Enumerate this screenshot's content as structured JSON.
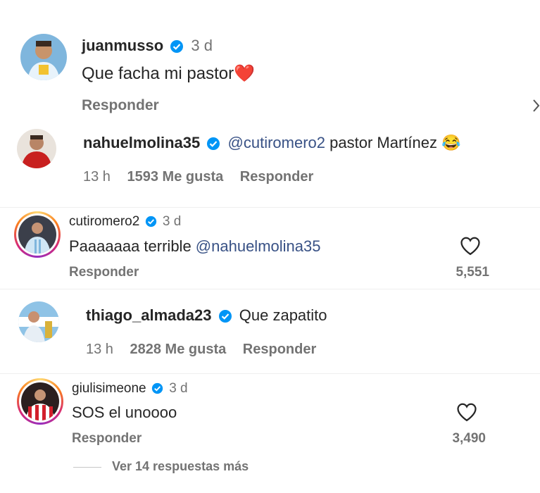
{
  "comments": [
    {
      "username": "juanmusso",
      "time": "3 d",
      "text": "Que facha mi pastor",
      "emoji": "❤️",
      "reply": "Responder"
    },
    {
      "username": "nahuelmolina35",
      "mention": "@cutiromero2",
      "text": " pastor Martínez",
      "emoji": "😂",
      "time": "13 h",
      "likes": "1593 Me gusta",
      "reply": "Responder"
    },
    {
      "username": "cutiromero2",
      "time": "3 d",
      "text": "Paaaaaaa terrible ",
      "mention": "@nahuelmolina35",
      "reply": "Responder",
      "like_count": "5,551"
    },
    {
      "username": "thiago_almada23",
      "text": "Que zapatito",
      "time": "13 h",
      "likes": "2828 Me gusta",
      "reply": "Responder"
    },
    {
      "username": "giulisimeone",
      "time": "3 d",
      "text": "SOS el unoooo",
      "reply": "Responder",
      "like_count": "3,490",
      "view_replies": "Ver 14 respuestas más"
    }
  ],
  "icons": {
    "verified": "verified-badge-icon",
    "heart": "heart-outline-icon"
  },
  "colors": {
    "verified": "#0095f6",
    "mention": "#385185",
    "muted": "#737373"
  }
}
